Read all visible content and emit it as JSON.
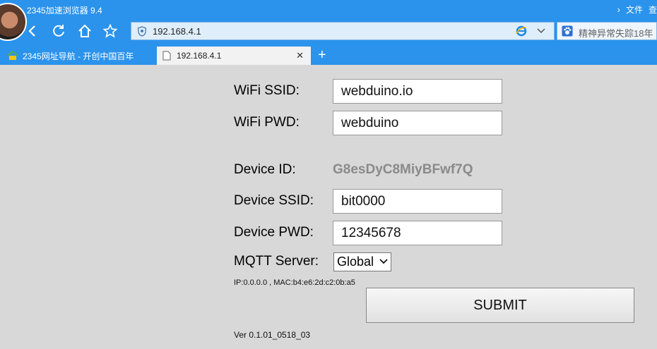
{
  "browser": {
    "app_title": "2345加速浏览器 9.4",
    "menu": [
      "文件",
      "查"
    ],
    "address_url": "192.168.4.1",
    "search_placeholder": "精神异常失踪18年",
    "tabs": [
      {
        "label": "2345网址导航 - 开创中国百年"
      },
      {
        "label": "192.168.4.1"
      }
    ]
  },
  "form": {
    "wifi_ssid_label": "WiFi SSID:",
    "wifi_ssid_value": "webduino.io",
    "wifi_pwd_label": "WiFi PWD:",
    "wifi_pwd_value": "webduino",
    "device_id_label": "Device ID:",
    "device_id_value": "G8esDyC8MiyBFwf7Q",
    "device_ssid_label": "Device SSID:",
    "device_ssid_value": "bit0000",
    "device_pwd_label": "Device PWD:",
    "device_pwd_value": "12345678",
    "mqtt_label": "MQTT Server:",
    "mqtt_selected": "Global",
    "ip_info": "IP:0.0.0.0 , MAC:b4:e6:2d:c2:0b:a5",
    "submit_label": "SUBMIT",
    "version": "Ver 0.1.01_0518_03"
  },
  "colors": {
    "chrome_blue": "#2b93ec",
    "page_bg": "#d8d8d8",
    "device_id_gray": "#8a8a8a"
  }
}
